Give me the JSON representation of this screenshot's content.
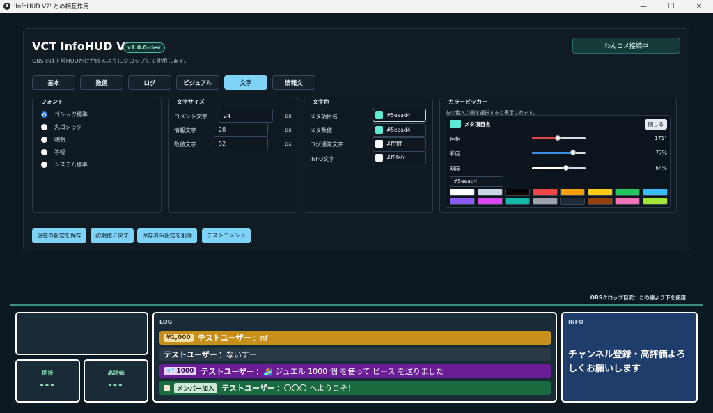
{
  "window": {
    "title": "'InfoHUD V2' との相互作用",
    "min": "—",
    "max": "☐",
    "close": "✕"
  },
  "header": {
    "title": "VCT InfoHUD V2",
    "version": "v1.0.0-dev",
    "subtitle": "OBSでは下部HUDだけが映るようにクロップして使用します。",
    "connect_status": "わんコメ接続中"
  },
  "tabs": [
    {
      "label": "基本",
      "active": false
    },
    {
      "label": "数値",
      "active": false
    },
    {
      "label": "ログ",
      "active": false
    },
    {
      "label": "ビジュアル",
      "active": false
    },
    {
      "label": "文字",
      "active": true
    },
    {
      "label": "情報文",
      "active": false
    }
  ],
  "font": {
    "title": "フォント",
    "options": [
      "ゴシック標準",
      "丸ゴシック",
      "明朝",
      "等幅",
      "システム標準"
    ],
    "selected": "ゴシック標準"
  },
  "size": {
    "title": "文字サイズ",
    "fields": [
      {
        "label": "コメント文字",
        "value": "24",
        "unit": "px"
      },
      {
        "label": "情報文字",
        "value": "28",
        "unit": "px"
      },
      {
        "label": "数値文字",
        "value": "52",
        "unit": "px"
      }
    ]
  },
  "text_color": {
    "title": "文字色",
    "fields": [
      {
        "label": "メタ項目名",
        "value": "#5eead4",
        "swatch": "#5eead4"
      },
      {
        "label": "メタ数値",
        "value": "#5eead4",
        "swatch": "#5eead4"
      },
      {
        "label": "ログ通常文字",
        "value": "#ffffff",
        "swatch": "#ffffff"
      },
      {
        "label": "INFO文字",
        "value": "#f8fafc",
        "swatch": "#f8fafc"
      }
    ]
  },
  "picker": {
    "title": "カラーピッカー",
    "hint": "左の色入力欄を選択すると表示されます。",
    "target": "メタ項目名",
    "close": "閉じる",
    "hue_label": "色相",
    "hue_value": "171°",
    "hue_fraction": 0.475,
    "sat_label": "彩度",
    "sat_value": "77%",
    "sat_fraction": 0.77,
    "light_label": "明度",
    "light_value": "64%",
    "light_fraction": 0.64,
    "hex": "#5eead4",
    "presets": [
      "#ffffff",
      "#cbd5e1",
      "#000000",
      "#ef4444",
      "#f59e0b",
      "#facc15",
      "#22c55e",
      "#38bdf8",
      "#8b5cf6",
      "#d946ef",
      "#14b8a6",
      "#9ca3af",
      "#1f2937",
      "#92400e",
      "#f472b6",
      "#a3e635"
    ]
  },
  "actions": {
    "save": "現在の設定を保存",
    "reset": "初期値に戻す",
    "delete": "保存済み設定を削除",
    "test": "テストコメント"
  },
  "crop_note": "OBSクロップ目安：この線より下を使用",
  "hud": {
    "stat1_label": "同接",
    "stat1_value": "---",
    "stat2_label": "高評価",
    "stat2_value": "---",
    "log_title": "LOG",
    "logs": [
      {
        "chip": "¥1,000",
        "name": "テストユーザー",
        "text": "：nf",
        "bg": "#c8901a",
        "chip_bg": "#f5e1a8",
        "chip_color": "#5a3a00"
      },
      {
        "chip": "",
        "name": "テストユーザー",
        "text": "：ないすー",
        "bg": "#2a3946",
        "chip_bg": "",
        "chip_color": ""
      },
      {
        "chip": "💎 1000",
        "name": "テストユーザー",
        "text": "：🏄 ジュエル 1000 個 を使って ピース を送りました",
        "bg": "#6b1d96",
        "chip_bg": "#e6d5f5",
        "chip_color": "#3a0e5a"
      },
      {
        "chip": "メンバー加入",
        "name": "テストユーザー",
        "text": "：〇〇〇 へようこそ！",
        "bg": "#1a6b3f",
        "chip_bg": "#cfe9d9",
        "chip_color": "#0c3a20"
      }
    ],
    "info_title": "INFO",
    "info_text": "チャンネル登録・高評価よろしくお願いします"
  }
}
